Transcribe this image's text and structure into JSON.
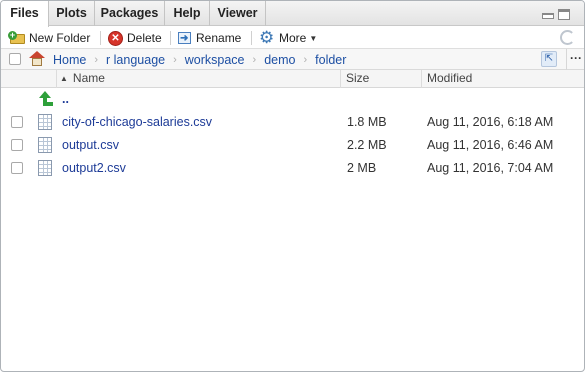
{
  "tabs": [
    {
      "label": "Files",
      "active": true
    },
    {
      "label": "Plots",
      "active": false
    },
    {
      "label": "Packages",
      "active": false
    },
    {
      "label": "Help",
      "active": false
    },
    {
      "label": "Viewer",
      "active": false
    }
  ],
  "toolbar": {
    "new_folder": "New Folder",
    "delete": "Delete",
    "rename": "Rename",
    "more": "More"
  },
  "breadcrumb": [
    "Home",
    "r language",
    "workspace",
    "demo",
    "folder"
  ],
  "columns": {
    "name": "Name",
    "size": "Size",
    "modified": "Modified"
  },
  "parent_link": "..",
  "files": [
    {
      "name": "city-of-chicago-salaries.csv",
      "size": "1.8 MB",
      "modified": "Aug 11, 2016, 6:18 AM"
    },
    {
      "name": "output.csv",
      "size": "2.2 MB",
      "modified": "Aug 11, 2016, 6:46 AM"
    },
    {
      "name": "output2.csv",
      "size": "2 MB",
      "modified": "Aug 11, 2016, 7:04 AM"
    }
  ],
  "icons": {
    "new_folder": "new-folder-icon",
    "delete": "delete-icon",
    "rename": "rename-icon",
    "more": "gear-icon",
    "home": "home-icon",
    "parent": "up-arrow-icon",
    "file": "csv-file-icon",
    "refresh": "refresh-icon"
  },
  "colors": {
    "link": "#1d3b97",
    "breadcrumb": "#1d4fa3",
    "up_arrow": "#2ea03a",
    "delete": "#d6342a"
  }
}
